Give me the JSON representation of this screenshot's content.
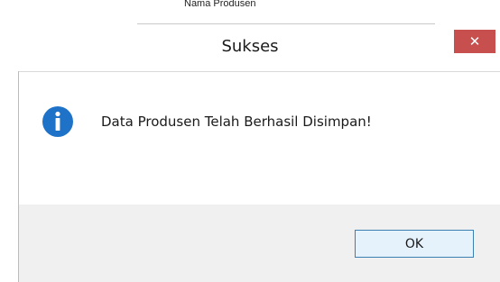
{
  "background_window": {
    "field_label": "Nama Produsen"
  },
  "dialog": {
    "title": "Sukses",
    "close_label": "✕",
    "icon": "information-icon",
    "message": "Data Produsen Telah Berhasil Disimpan!",
    "ok_label": "OK"
  },
  "colors": {
    "close_button": "#c7504f",
    "info_icon": "#1e73c8",
    "footer": "#f0f0f0",
    "ok_border": "#3c7fb1"
  }
}
